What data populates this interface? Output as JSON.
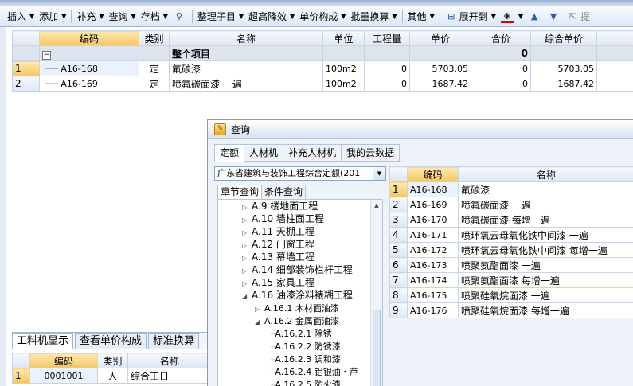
{
  "toolbar": [
    {
      "label": "插入",
      "dropdown": true
    },
    {
      "label": "添加",
      "dropdown": true
    },
    {
      "label": "补充",
      "dropdown": true
    },
    {
      "label": "查询",
      "dropdown": true
    },
    {
      "label": "存档",
      "dropdown": true
    },
    {
      "label": "",
      "icon": "binoculars-icon"
    },
    {
      "label": "整理子目",
      "dropdown": true
    },
    {
      "label": "超高降效",
      "dropdown": true
    },
    {
      "label": "单价构成",
      "dropdown": true
    },
    {
      "label": "批量换算",
      "dropdown": true
    },
    {
      "label": "其他",
      "dropdown": true
    },
    {
      "label": "展开到",
      "dropdown": true,
      "icon": "expand-icon"
    },
    {
      "label": "",
      "dropdown": true,
      "icon": "fill-color-icon"
    },
    {
      "label": "",
      "icon": "arrow-up-icon"
    },
    {
      "label": "",
      "icon": "arrow-down-icon"
    },
    {
      "label": "提",
      "icon": "lift-icon"
    }
  ],
  "main_grid": {
    "headers": [
      "编码",
      "类别",
      "名称",
      "单位",
      "工程量",
      "单价",
      "合价",
      "综合单价"
    ],
    "summary_row": {
      "toggle": "−",
      "name": "整个项目",
      "amount": "0"
    },
    "rows": [
      {
        "num": "1",
        "code": "A16-168",
        "type": "定",
        "name": "氟碳漆",
        "unit": "100m2",
        "qty": "0",
        "price": "5703.05",
        "total": "0",
        "unit_price": "5703.05"
      },
      {
        "num": "2",
        "code": "A16-169",
        "type": "定",
        "name": "喷氟碳面漆 一遍",
        "unit": "100m2",
        "qty": "0",
        "price": "1687.42",
        "total": "0",
        "unit_price": "1687.42"
      }
    ]
  },
  "lower_tabs": [
    "工料机显示",
    "查看单价构成",
    "标准换算"
  ],
  "lower_grid": {
    "headers": [
      "编码",
      "类别",
      "名称"
    ],
    "rows": [
      {
        "num": "1",
        "code": "0001001",
        "type": "人",
        "name": "综合工日"
      }
    ]
  },
  "dialog": {
    "title": "查询",
    "tabs": [
      "定额",
      "人材机",
      "补充人材机",
      "我的云数据"
    ],
    "library": "广东省建筑与装饰工程综合定额(201",
    "subtabs": [
      "章节查询",
      "条件查询"
    ],
    "tree": [
      {
        "label": "A.9 楼地面工程",
        "level": 0,
        "expander": "collapsed"
      },
      {
        "label": "A.10 墙柱面工程",
        "level": 0,
        "expander": "collapsed"
      },
      {
        "label": "A.11 天棚工程",
        "level": 0,
        "expander": "collapsed"
      },
      {
        "label": "A.12 门窗工程",
        "level": 0,
        "expander": "collapsed"
      },
      {
        "label": "A.13 幕墙工程",
        "level": 0,
        "expander": "collapsed"
      },
      {
        "label": "A.14 细部装饰栏杆工程",
        "level": 0,
        "expander": "collapsed"
      },
      {
        "label": "A.15 家具工程",
        "level": 0,
        "expander": "collapsed"
      },
      {
        "label": "A.16 油漆涂料裱糊工程",
        "level": 0,
        "expander": "expanded"
      },
      {
        "label": "A.16.1 木材面油漆",
        "level": 1,
        "expander": "collapsed"
      },
      {
        "label": "A.16.2 金属面油漆",
        "level": 1,
        "expander": "expanded"
      },
      {
        "label": "A.16.2.1 除锈",
        "level": 2,
        "expander": "none"
      },
      {
        "label": "A.16.2.2 防锈漆",
        "level": 2,
        "expander": "none"
      },
      {
        "label": "A.16.2.3 调和漆",
        "level": 2,
        "expander": "none"
      },
      {
        "label": "A.16.2.4 铝银油・芦",
        "level": 2,
        "expander": "none"
      },
      {
        "label": "A.16.2.5 防火漆",
        "level": 2,
        "expander": "none"
      }
    ],
    "results_headers": [
      "编码",
      "名称"
    ],
    "results": [
      {
        "num": "1",
        "code": "A16-168",
        "name": "氟碳漆"
      },
      {
        "num": "2",
        "code": "A16-169",
        "name": "喷氟碳面漆 一遍"
      },
      {
        "num": "3",
        "code": "A16-170",
        "name": "喷氟碳面漆 每增一遍"
      },
      {
        "num": "4",
        "code": "A16-171",
        "name": "喷环氧云母氧化铁中间漆 一遍"
      },
      {
        "num": "5",
        "code": "A16-172",
        "name": "喷环氧云母氧化铁中间漆 每增一遍"
      },
      {
        "num": "6",
        "code": "A16-173",
        "name": "喷聚氨酯面漆 一遍"
      },
      {
        "num": "7",
        "code": "A16-174",
        "name": "喷聚氨酯面漆 每增一遍"
      },
      {
        "num": "8",
        "code": "A16-175",
        "name": "喷聚硅氧烷面漆 一遍"
      },
      {
        "num": "9",
        "code": "A16-176",
        "name": "喷聚硅氧烷面漆 每增一遍"
      }
    ]
  }
}
